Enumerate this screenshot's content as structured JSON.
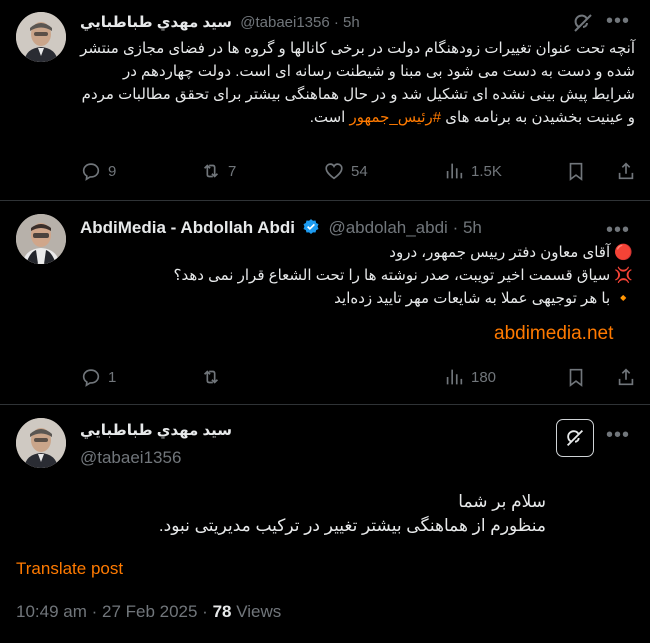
{
  "tweet1": {
    "name": "سيد مهدي طباطبايي",
    "handle": "@tabaei1356",
    "time": "5h",
    "text_pre": "آنچه تحت عنوان تغییرات زودهنگام دولت در برخی کانالها و گروه ها در فضای مجازی منتشر شده و دست به دست می شود بی مبنا و شیطنت رسانه ای است. دولت چهاردهم در شرایط پیش بینی نشده ای تشکیل شد و در حال هماهنگی بیشتر برای تحقق مطالبات مردم و عینیت بخشیدن به برنامه های ",
    "hashtag": "#رئیس_جمهور",
    "text_post": " است.",
    "replies": "9",
    "reposts": "7",
    "likes": "54",
    "views": "1.5K"
  },
  "tweet2": {
    "name": "AbdiMedia - Abdollah Abdi",
    "handle": "@abdolah_abdi",
    "time": "5h",
    "line1_emoji": "🔴",
    "line1": "آقای معاون دفتر رییس جمهور، درود",
    "line2_emoji": "💢",
    "line2": "سیاق قسمت اخیر تویبت، صدر نوشته ها را تحت الشعاع قرار نمی دهد؟",
    "line3_emoji": "🔸",
    "line3": "با هر توجیهی عملا به شایعات مهر تایید زده‌اید",
    "link": "abdimedia.net",
    "replies": "1",
    "reposts": "",
    "views": "180"
  },
  "tweet3": {
    "name": "سيد مهدي طباطبايي",
    "handle": "@tabaei1356",
    "line1": "سلام بر شما",
    "line2": "منظورم از هماهنگی بیشتر تغییر در ترکیب مدیریتی نبود.",
    "translate": "Translate post",
    "timestamp": "10:49 am · 27 Feb 2025 · ",
    "views_count": "78",
    "views_label": " Views"
  },
  "colors": {
    "accent": "#ff7a00",
    "muted": "#71767b",
    "verified": "#1d9bf0",
    "background": "#000000"
  },
  "icons": [
    "reply-icon",
    "repost-icon",
    "like-icon",
    "views-icon",
    "bookmark-icon",
    "share-icon",
    "grok-icon",
    "more-icon",
    "verified-icon"
  ]
}
